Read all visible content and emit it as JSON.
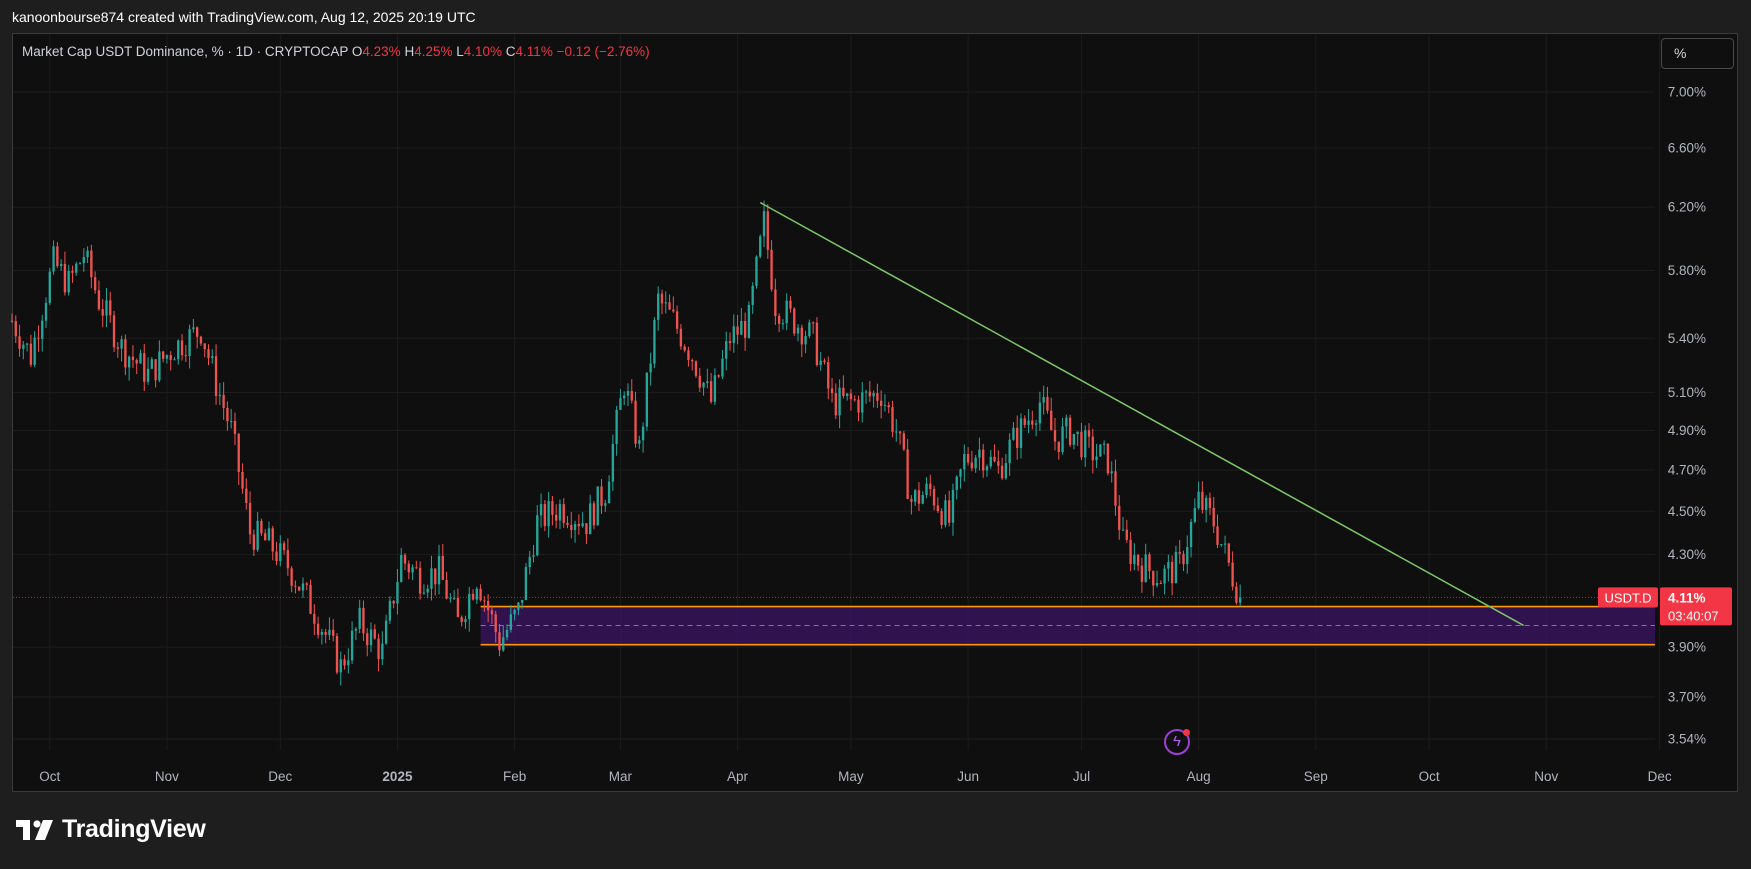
{
  "attribution": "kanoonbourse874 created with TradingView.com, Aug 12, 2025 20:19 UTC",
  "legend": {
    "title": "Market Cap USDT Dominance, % · 1D · CRYPTOCAP",
    "open_label": "O",
    "open": "4.23%",
    "high_label": "H",
    "high": "4.25%",
    "low_label": "L",
    "low": "4.10%",
    "close_label": "C",
    "close": "4.11%",
    "change": "−0.12 (−2.76%)"
  },
  "scale_button": "%",
  "price_badge": {
    "symbol": "USDT.D",
    "price": "4.11%",
    "countdown": "03:40:07"
  },
  "branding": {
    "logo_text": "TradingView"
  },
  "icons": {
    "flash": "lightning-bolt-icon",
    "logo": "tradingview-logo-icon"
  },
  "colors": {
    "up": "#26a69a",
    "down": "#ef5350",
    "trendline": "#7ec86a",
    "zone": "#ff9800",
    "zone_fill": "#3c1466",
    "badge": "#f23645"
  },
  "chart_data": {
    "type": "candlestick",
    "series_name": "Market Cap USDT Dominance",
    "y_scale": "log",
    "y_ticks": [
      "7.00%",
      "6.60%",
      "6.20%",
      "5.80%",
      "5.40%",
      "5.10%",
      "4.90%",
      "4.70%",
      "4.50%",
      "4.30%",
      "3.90%",
      "3.70%",
      "3.54%"
    ],
    "x_ticks": [
      "Oct",
      "Nov",
      "Dec",
      "2025",
      "Feb",
      "Mar",
      "Apr",
      "May",
      "Jun",
      "Jul",
      "Aug",
      "Sep",
      "Oct",
      "Nov",
      "Dec"
    ],
    "x_range": [
      "2024-09-21",
      "2025-12-22"
    ],
    "last_price": 4.11,
    "waypoints": [
      [
        "2024-09-21",
        5.5
      ],
      [
        "2024-09-26",
        5.3
      ],
      [
        "2024-10-02",
        5.85
      ],
      [
        "2024-10-06",
        5.72
      ],
      [
        "2024-10-10",
        5.9
      ],
      [
        "2024-10-14",
        5.62
      ],
      [
        "2024-10-20",
        5.35
      ],
      [
        "2024-10-27",
        5.2
      ],
      [
        "2024-11-03",
        5.35
      ],
      [
        "2024-11-10",
        5.45
      ],
      [
        "2024-11-14",
        5.15
      ],
      [
        "2024-11-18",
        4.9
      ],
      [
        "2024-11-23",
        4.4
      ],
      [
        "2024-11-28",
        4.35
      ],
      [
        "2024-12-03",
        4.25
      ],
      [
        "2024-12-10",
        4.05
      ],
      [
        "2024-12-17",
        3.82
      ],
      [
        "2024-12-22",
        4.0
      ],
      [
        "2024-12-28",
        3.88
      ],
      [
        "2025-01-02",
        4.28
      ],
      [
        "2025-01-07",
        4.2
      ],
      [
        "2025-01-12",
        4.22
      ],
      [
        "2025-01-17",
        4.0
      ],
      [
        "2025-01-22",
        4.2
      ],
      [
        "2025-01-28",
        3.92
      ],
      [
        "2025-02-02",
        4.05
      ],
      [
        "2025-02-07",
        4.45
      ],
      [
        "2025-02-13",
        4.52
      ],
      [
        "2025-02-20",
        4.45
      ],
      [
        "2025-02-25",
        4.6
      ],
      [
        "2025-03-02",
        5.15
      ],
      [
        "2025-03-06",
        4.8
      ],
      [
        "2025-03-11",
        5.62
      ],
      [
        "2025-03-15",
        5.5
      ],
      [
        "2025-03-20",
        5.3
      ],
      [
        "2025-03-25",
        5.05
      ],
      [
        "2025-03-30",
        5.4
      ],
      [
        "2025-04-04",
        5.5
      ],
      [
        "2025-04-08",
        6.1
      ],
      [
        "2025-04-11",
        5.6
      ],
      [
        "2025-04-16",
        5.5
      ],
      [
        "2025-04-21",
        5.4
      ],
      [
        "2025-04-26",
        5.05
      ],
      [
        "2025-05-02",
        5.05
      ],
      [
        "2025-05-09",
        5.1
      ],
      [
        "2025-05-13",
        4.9
      ],
      [
        "2025-05-17",
        4.55
      ],
      [
        "2025-05-22",
        4.6
      ],
      [
        "2025-05-27",
        4.45
      ],
      [
        "2025-05-31",
        4.75
      ],
      [
        "2025-06-04",
        4.8
      ],
      [
        "2025-06-09",
        4.7
      ],
      [
        "2025-06-13",
        4.85
      ],
      [
        "2025-06-20",
        5.05
      ],
      [
        "2025-06-24",
        4.85
      ],
      [
        "2025-06-28",
        4.9
      ],
      [
        "2025-07-03",
        4.8
      ],
      [
        "2025-07-08",
        4.75
      ],
      [
        "2025-07-12",
        4.35
      ],
      [
        "2025-07-17",
        4.25
      ],
      [
        "2025-07-22",
        4.2
      ],
      [
        "2025-07-27",
        4.25
      ],
      [
        "2025-08-01",
        4.55
      ],
      [
        "2025-08-05",
        4.45
      ],
      [
        "2025-08-09",
        4.25
      ],
      [
        "2025-08-12",
        4.11
      ]
    ],
    "trendline": {
      "from": [
        "2025-04-07",
        6.23
      ],
      "to": [
        "2025-10-26",
        3.99
      ]
    },
    "support_zone": {
      "from_date": "2025-01-23",
      "top": 4.07,
      "mid": 3.99,
      "bottom": 3.91
    }
  }
}
